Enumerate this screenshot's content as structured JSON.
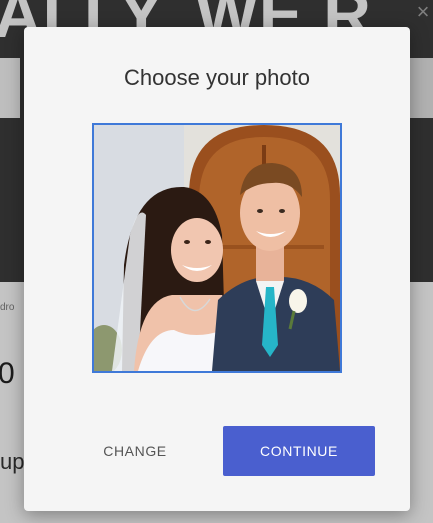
{
  "background": {
    "hero_text": "ALLY, WE R",
    "small_label": "dro",
    "big_char": "0",
    "lower_text": "up",
    "close_symbol": "×"
  },
  "modal": {
    "title": "Choose your photo",
    "photo_alt": "Selected photo of a bride and groom",
    "buttons": {
      "change": "CHANGE",
      "continue": "CONTINUE"
    }
  },
  "colors": {
    "accent": "#4a5fcf",
    "frame_border": "#3f79d8",
    "modal_bg": "#f5f5f5"
  }
}
